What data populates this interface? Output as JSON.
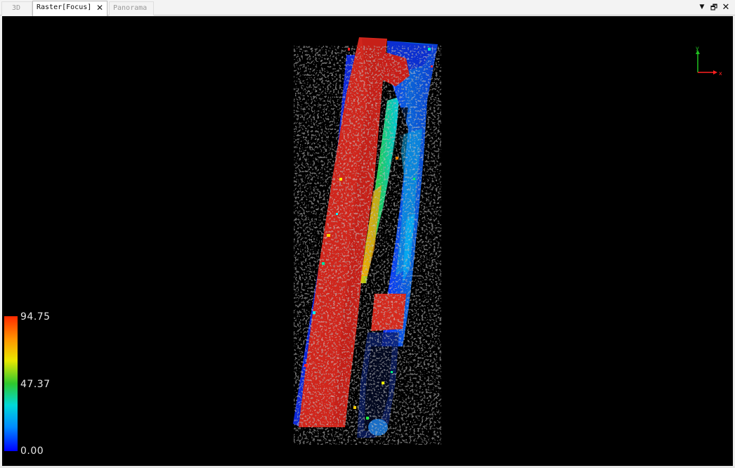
{
  "tabs": [
    {
      "label": "3D",
      "active": false
    },
    {
      "label": "Raster[Focus]",
      "active": true
    },
    {
      "label": "Panorama",
      "active": false
    }
  ],
  "window_controls": {
    "menu_icon": "triangle-down-icon",
    "restore_icon": "restore-window-icon",
    "close_icon": "close-icon"
  },
  "axes": {
    "x_label": "x",
    "y_label": "y",
    "x_color": "#ff2020",
    "y_color": "#20c020"
  },
  "legend": {
    "max": "94.75",
    "mid": "47.37",
    "min": "0.00",
    "colors": [
      "#0000ff",
      "#00d8d8",
      "#2ec82e",
      "#e8e800",
      "#ff9a00",
      "#ff2a00"
    ]
  }
}
